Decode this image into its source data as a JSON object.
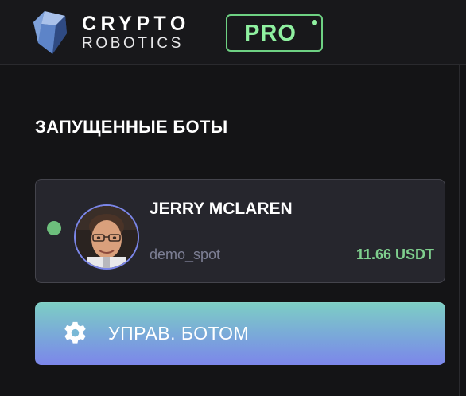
{
  "header": {
    "brand_line1": "CRYPTO",
    "brand_line2": "ROBOTICS",
    "pro_badge": "PRO",
    "logo_icon": "crystal-logo-icon",
    "accent_green": "#8ff0a0"
  },
  "main": {
    "section_title": "ЗАПУЩЕННЫЕ БОТЫ",
    "bots": [
      {
        "name": "JERRY MCLAREN",
        "type": "demo_spot",
        "balance": "11.66 USDT",
        "status": "active",
        "status_color": "#6dbf7c",
        "avatar_icon": "avatar-photo"
      }
    ],
    "manage_button": {
      "label": "УПРАВ. БОТОМ",
      "icon": "gear-icon"
    }
  }
}
